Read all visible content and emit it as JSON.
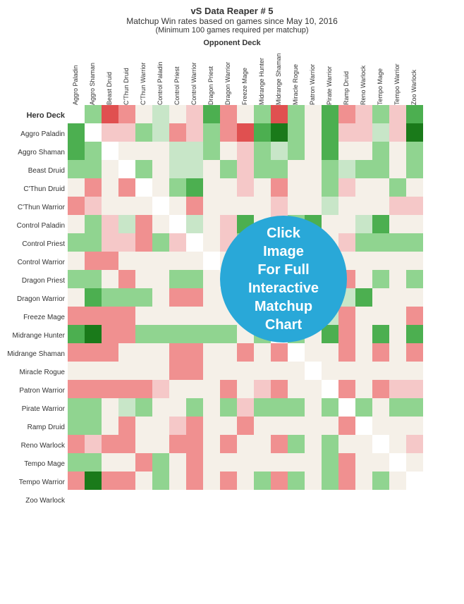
{
  "title": {
    "line1": "vS Data Reaper # 5",
    "line2": "Matchup Win rates based on games since May 10, 2016",
    "line3": "(Minimum 100 games required per matchup)"
  },
  "opponent_label": "Opponent Deck",
  "col_headers": [
    "Aggro Paladin",
    "Aggro Shaman",
    "Beast Druid",
    "C'Thun Druid",
    "C'Thun Warrior",
    "Control Paladin",
    "Control Priest",
    "Control Warrior",
    "Dragon Priest",
    "Dragon Warrior",
    "Freeze Mage",
    "Midrange Hunter",
    "Midrange Shaman",
    "Miracle Rogue",
    "Patron Warrior",
    "Pirate Warrior",
    "Ramp Druid",
    "Reno Warlock",
    "Tempo Mage",
    "Tempo Warrior",
    "Zoo Warlock"
  ],
  "row_headers": [
    "Aggro Paladin",
    "Aggro Shaman",
    "Beast Druid",
    "C'Thun Druid",
    "C'Thun Warrior",
    "Control Paladin",
    "Control Priest",
    "Control Warrior",
    "Dragon Priest",
    "Dragon Warrior",
    "Freeze Mage",
    "Midrange Hunter",
    "Midrange Shaman",
    "Miracle Rogue",
    "Patron Warrior",
    "Pirate Warrior",
    "Ramp Druid",
    "Reno Warlock",
    "Tempo Mage",
    "Tempo Warrior",
    "Zoo Warlock"
  ],
  "overlay": {
    "text": "Click\nImage\nFor Full\nInteractive\nMatchup\nChart"
  },
  "grid_data": [
    [
      "w",
      "lg",
      "r",
      "lr",
      "n",
      "vlg",
      "n",
      "vlr",
      "g",
      "lr",
      "n",
      "lg",
      "r",
      "lg",
      "n",
      "g",
      "lr",
      "vlr",
      "lg",
      "vlr",
      "g"
    ],
    [
      "g",
      "w",
      "vlr",
      "vlr",
      "lg",
      "vlg",
      "lr",
      "vlr",
      "lg",
      "lr",
      "r",
      "g",
      "dg",
      "lg",
      "n",
      "g",
      "vlr",
      "vlr",
      "vlg",
      "vlr",
      "dg"
    ],
    [
      "g",
      "lg",
      "w",
      "n",
      "n",
      "n",
      "vlg",
      "vlg",
      "lg",
      "n",
      "vlr",
      "lg",
      "vlg",
      "lg",
      "n",
      "g",
      "n",
      "n",
      "lg",
      "n",
      "lg"
    ],
    [
      "lg",
      "lg",
      "n",
      "w",
      "lg",
      "n",
      "vlg",
      "vlg",
      "n",
      "lg",
      "vlr",
      "lg",
      "lg",
      "n",
      "n",
      "lg",
      "vlg",
      "lg",
      "lg",
      "n",
      "lg"
    ],
    [
      "n",
      "lr",
      "n",
      "lr",
      "w",
      "n",
      "lg",
      "g",
      "n",
      "n",
      "vlr",
      "n",
      "lr",
      "n",
      "n",
      "lg",
      "vlr",
      "n",
      "n",
      "lg",
      "n"
    ],
    [
      "lr",
      "vlr",
      "n",
      "n",
      "n",
      "w",
      "n",
      "lr",
      "n",
      "n",
      "n",
      "n",
      "vlr",
      "n",
      "n",
      "vlg",
      "n",
      "n",
      "n",
      "vlr",
      "vlr"
    ],
    [
      "n",
      "lg",
      "vlr",
      "vlg",
      "lr",
      "n",
      "w",
      "vlg",
      "n",
      "vlr",
      "g",
      "n",
      "vlr",
      "lg",
      "g",
      "n",
      "n",
      "vlg",
      "g",
      "n",
      "n"
    ],
    [
      "lg",
      "lg",
      "vlr",
      "vlr",
      "lr",
      "lg",
      "vlr",
      "w",
      "n",
      "vlr",
      "lg",
      "n",
      "vlr",
      "lg",
      "lg",
      "n",
      "vlr",
      "lg",
      "lg",
      "lg",
      "lg"
    ],
    [
      "n",
      "lr",
      "lr",
      "n",
      "n",
      "n",
      "n",
      "n",
      "w",
      "n",
      "n",
      "n",
      "lr",
      "n",
      "n",
      "n",
      "n",
      "n",
      "n",
      "n",
      "n"
    ],
    [
      "lg",
      "lg",
      "n",
      "lr",
      "n",
      "n",
      "lg",
      "lg",
      "n",
      "w",
      "n",
      "n",
      "vlr",
      "n",
      "n",
      "g",
      "lr",
      "n",
      "lg",
      "n",
      "lg"
    ],
    [
      "n",
      "g",
      "lg",
      "lg",
      "lg",
      "n",
      "lr",
      "lr",
      "n",
      "n",
      "w",
      "n",
      "n",
      "lg",
      "n",
      "n",
      "vlg",
      "g",
      "n",
      "n",
      "n"
    ],
    [
      "lr",
      "lr",
      "lr",
      "lr",
      "n",
      "n",
      "n",
      "n",
      "n",
      "n",
      "n",
      "w",
      "vlr",
      "n",
      "n",
      "vlg",
      "lr",
      "n",
      "n",
      "n",
      "lr"
    ],
    [
      "g",
      "dg",
      "lr",
      "lr",
      "lg",
      "lg",
      "lg",
      "lg",
      "lg",
      "lg",
      "n",
      "lg",
      "w",
      "lg",
      "n",
      "g",
      "lr",
      "n",
      "g",
      "n",
      "g"
    ],
    [
      "lr",
      "lr",
      "lr",
      "n",
      "n",
      "n",
      "lr",
      "lr",
      "n",
      "n",
      "lr",
      "n",
      "lr",
      "w",
      "n",
      "n",
      "lr",
      "n",
      "lr",
      "n",
      "lr"
    ],
    [
      "n",
      "n",
      "n",
      "n",
      "n",
      "n",
      "lr",
      "lr",
      "n",
      "n",
      "n",
      "n",
      "n",
      "n",
      "w",
      "n",
      "n",
      "n",
      "n",
      "n",
      "n"
    ],
    [
      "lr",
      "lr",
      "lr",
      "lr",
      "lr",
      "vlr",
      "n",
      "n",
      "n",
      "lr",
      "n",
      "vlr",
      "lr",
      "n",
      "n",
      "w",
      "lr",
      "n",
      "lr",
      "vlr",
      "vlr"
    ],
    [
      "lg",
      "lg",
      "n",
      "vlg",
      "lg",
      "n",
      "n",
      "lg",
      "n",
      "lg",
      "vlr",
      "lg",
      "lg",
      "lg",
      "n",
      "lg",
      "w",
      "lg",
      "n",
      "lg",
      "lg"
    ],
    [
      "lg",
      "lg",
      "n",
      "lr",
      "n",
      "n",
      "vlr",
      "lr",
      "n",
      "n",
      "lr",
      "n",
      "n",
      "n",
      "n",
      "n",
      "lr",
      "w",
      "n",
      "n",
      "n"
    ],
    [
      "lr",
      "vlr",
      "lr",
      "lr",
      "n",
      "n",
      "lr",
      "lr",
      "n",
      "lr",
      "n",
      "n",
      "lr",
      "lg",
      "n",
      "lg",
      "n",
      "n",
      "w",
      "n",
      "vlr"
    ],
    [
      "lg",
      "lg",
      "n",
      "n",
      "lr",
      "lg",
      "n",
      "lr",
      "n",
      "n",
      "n",
      "n",
      "n",
      "n",
      "n",
      "lg",
      "lr",
      "n",
      "n",
      "w",
      "n"
    ],
    [
      "lr",
      "dg",
      "lr",
      "lr",
      "n",
      "lg",
      "n",
      "lr",
      "n",
      "lr",
      "n",
      "lg",
      "lr",
      "lg",
      "n",
      "lg",
      "lr",
      "n",
      "lg",
      "n",
      "w"
    ]
  ]
}
